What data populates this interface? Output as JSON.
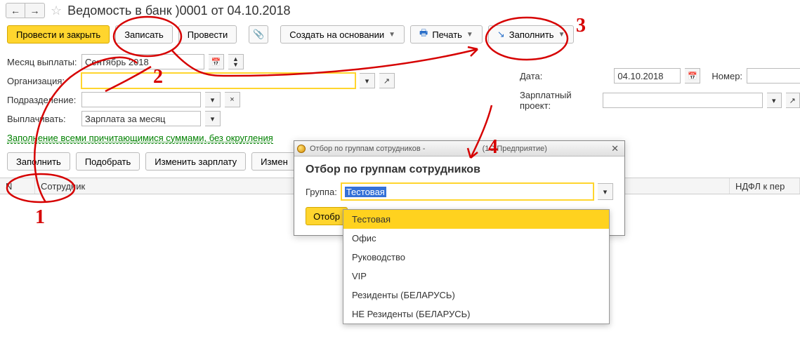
{
  "nav": {
    "back": "←",
    "fwd": "→",
    "star": "☆"
  },
  "title": "Ведомость в банк         )0001 от 04.10.2018",
  "toolbar": {
    "post_close": "Провести и закрыть",
    "save": "Записать",
    "post": "Провести",
    "attach": "📎",
    "create_based": "Создать на основании",
    "print": "Печать",
    "fill": "Заполнить"
  },
  "fields": {
    "month_label": "Месяц выплаты:",
    "month_value": "Сентябрь 2018",
    "org_label": "Организация:",
    "org_value": "",
    "dept_label": "Подразделение:",
    "pay_label": "Выплачивать:",
    "pay_value": "Зарплата за месяц",
    "date_label": "Дата:",
    "date_value": "04.10.2018",
    "num_label": "Номер:",
    "num_value": "",
    "project_label": "Зарплатный проект:",
    "project_value": ""
  },
  "link": "Заполнение всеми причитающимися суммами, без округления",
  "actions": {
    "fill": "Заполнить",
    "pick": "Подобрать",
    "edit_salary": "Изменить зарплату",
    "edit_truncated": "Измен"
  },
  "table": {
    "n": "N",
    "emp": "Сотрудник",
    "tax": "НДФЛ к пер"
  },
  "dialog": {
    "window_title_left": "Отбор по группам сотрудников -",
    "window_title_right": "(1С:Предприятие)",
    "close": "✕",
    "heading": "Отбор по группам сотрудников",
    "group_label": "Группа:",
    "group_value": "Тестовая",
    "select_btn": "Отобр"
  },
  "dropdown": {
    "items": [
      "Тестовая",
      "Офис",
      "Руководство",
      "VIP",
      "Резиденты (БЕЛАРУСЬ)",
      "НЕ Резиденты (БЕЛАРУСЬ)"
    ]
  },
  "ann": {
    "n1": "1",
    "n2": "2",
    "n3": "3",
    "n4": "4"
  }
}
